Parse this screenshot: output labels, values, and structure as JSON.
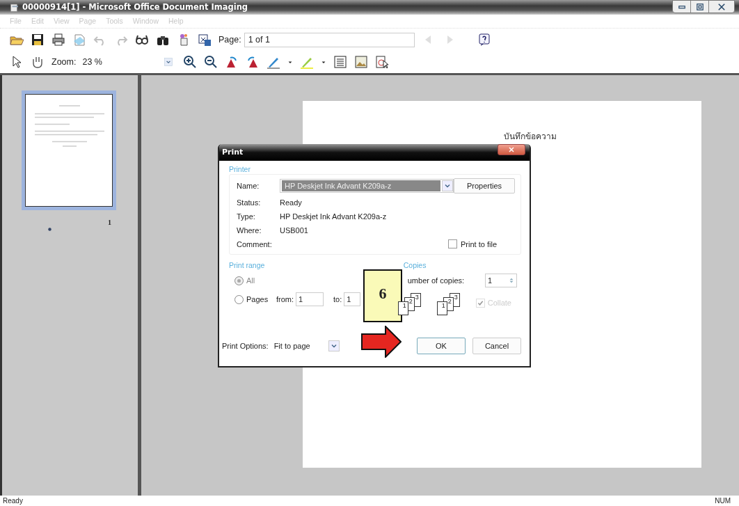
{
  "window": {
    "title": "00000914[1] - Microsoft Office Document Imaging"
  },
  "menu": [
    {
      "label": "File",
      "disabled": true
    },
    {
      "label": "Edit",
      "disabled": true
    },
    {
      "label": "View",
      "disabled": true
    },
    {
      "label": "Page",
      "disabled": true
    },
    {
      "label": "Tools",
      "disabled": true
    },
    {
      "label": "Window",
      "disabled": true
    },
    {
      "label": "Help",
      "disabled": true
    }
  ],
  "toolbar": {
    "page_label": "Page:",
    "page_value": "1 of 1",
    "zoom_label": "Zoom:",
    "zoom_value": "23 %"
  },
  "thumbnails": [
    {
      "page_number": "1",
      "selected": true
    }
  ],
  "document": {
    "heading": "บันทึกข้อความ"
  },
  "print_dialog": {
    "title": "Print",
    "printer_group": "Printer",
    "name_label": "Name:",
    "name_value": "HP Deskjet Ink Advant K209a-z",
    "properties_button": "Properties",
    "info": [
      {
        "label": "Status:",
        "value": "Ready"
      },
      {
        "label": "Type:",
        "value": "HP Deskjet Ink Advant K209a-z"
      },
      {
        "label": "Where:",
        "value": "USB001"
      },
      {
        "label": "Comment:"
      }
    ],
    "print_to_file": {
      "label": "Print to file",
      "checked": false
    },
    "range_group": "Print range",
    "range_options": [
      {
        "label": "All",
        "selected": true,
        "disabled": true
      },
      {
        "label": "Pages",
        "selected": false,
        "disabled": false
      }
    ],
    "from_label": "from:",
    "from_value": "1",
    "to_label": "to:",
    "to_value": "1",
    "copies_group": "Copies",
    "copies_label": "umber of copies:",
    "copies_value": "1",
    "collate_stacks": [
      [
        "1",
        "2",
        "3"
      ],
      [
        "1",
        "2",
        "3"
      ]
    ],
    "collate": {
      "label": "Collate",
      "checked": true,
      "disabled": true
    },
    "print_options_label": "Print Options:",
    "print_options_value": "Fit to page",
    "buttons": [
      {
        "label": "OK",
        "default": true
      },
      {
        "label": "Cancel",
        "default": false
      }
    ]
  },
  "callout": {
    "number": "6"
  },
  "status_bar": {
    "left": "Ready",
    "right": "NUM"
  }
}
